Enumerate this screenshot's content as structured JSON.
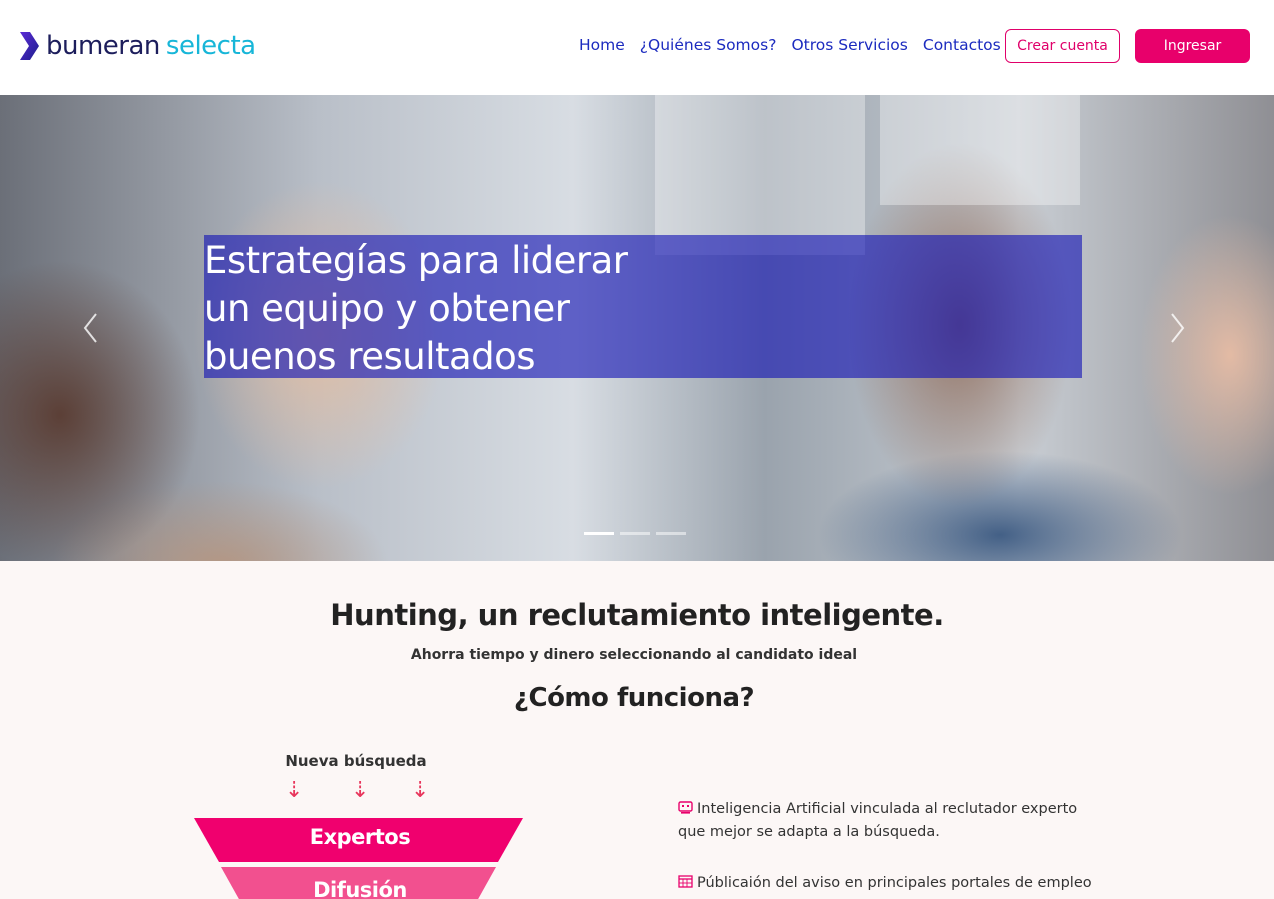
{
  "brand": {
    "name_part1": "bumeran",
    "name_part2": "selecta",
    "dark_color": "#1d1e5c",
    "accent_color": "#17b6d8"
  },
  "nav": {
    "items": [
      {
        "label": "Home"
      },
      {
        "label": "¿Quiénes Somos?"
      },
      {
        "label": "Otros Servicios"
      },
      {
        "label": "Contactos"
      }
    ]
  },
  "header_actions": {
    "create_account": "Crear cuenta",
    "login": "Ingresar",
    "primary_color": "#e8006b"
  },
  "hero": {
    "line1": "Estrategías para liderar",
    "line2": "un equipo y obtener",
    "line3": "buenos resultados",
    "prev_icon": "chevron-left-icon",
    "next_icon": "chevron-right-icon",
    "slides_count": 3,
    "active_slide": 1
  },
  "intro": {
    "title_bold": "Hunting",
    "title_rest": ", un reclutamiento inteligente.",
    "subtitle": "Ahorra tiempo y dinero seleccionando al candidato ideal",
    "how_prefix": "¿Cómo ",
    "how_bold": "funciona?"
  },
  "funnel": {
    "title": "Nueva búsqueda",
    "arrow_glyph": "⇣",
    "stages": [
      {
        "label": "Expertos",
        "color": "#f0006e"
      },
      {
        "label": "Difusión",
        "color": "#f2508f"
      }
    ]
  },
  "features": [
    {
      "icon": "ai-robot-icon",
      "text": "Inteligencia Artificial vinculada al reclutador experto que mejor se adapta a la búsqueda."
    },
    {
      "icon": "calendar-grid-icon",
      "text": "Públicaión del aviso en principales portales de empleo y"
    }
  ]
}
